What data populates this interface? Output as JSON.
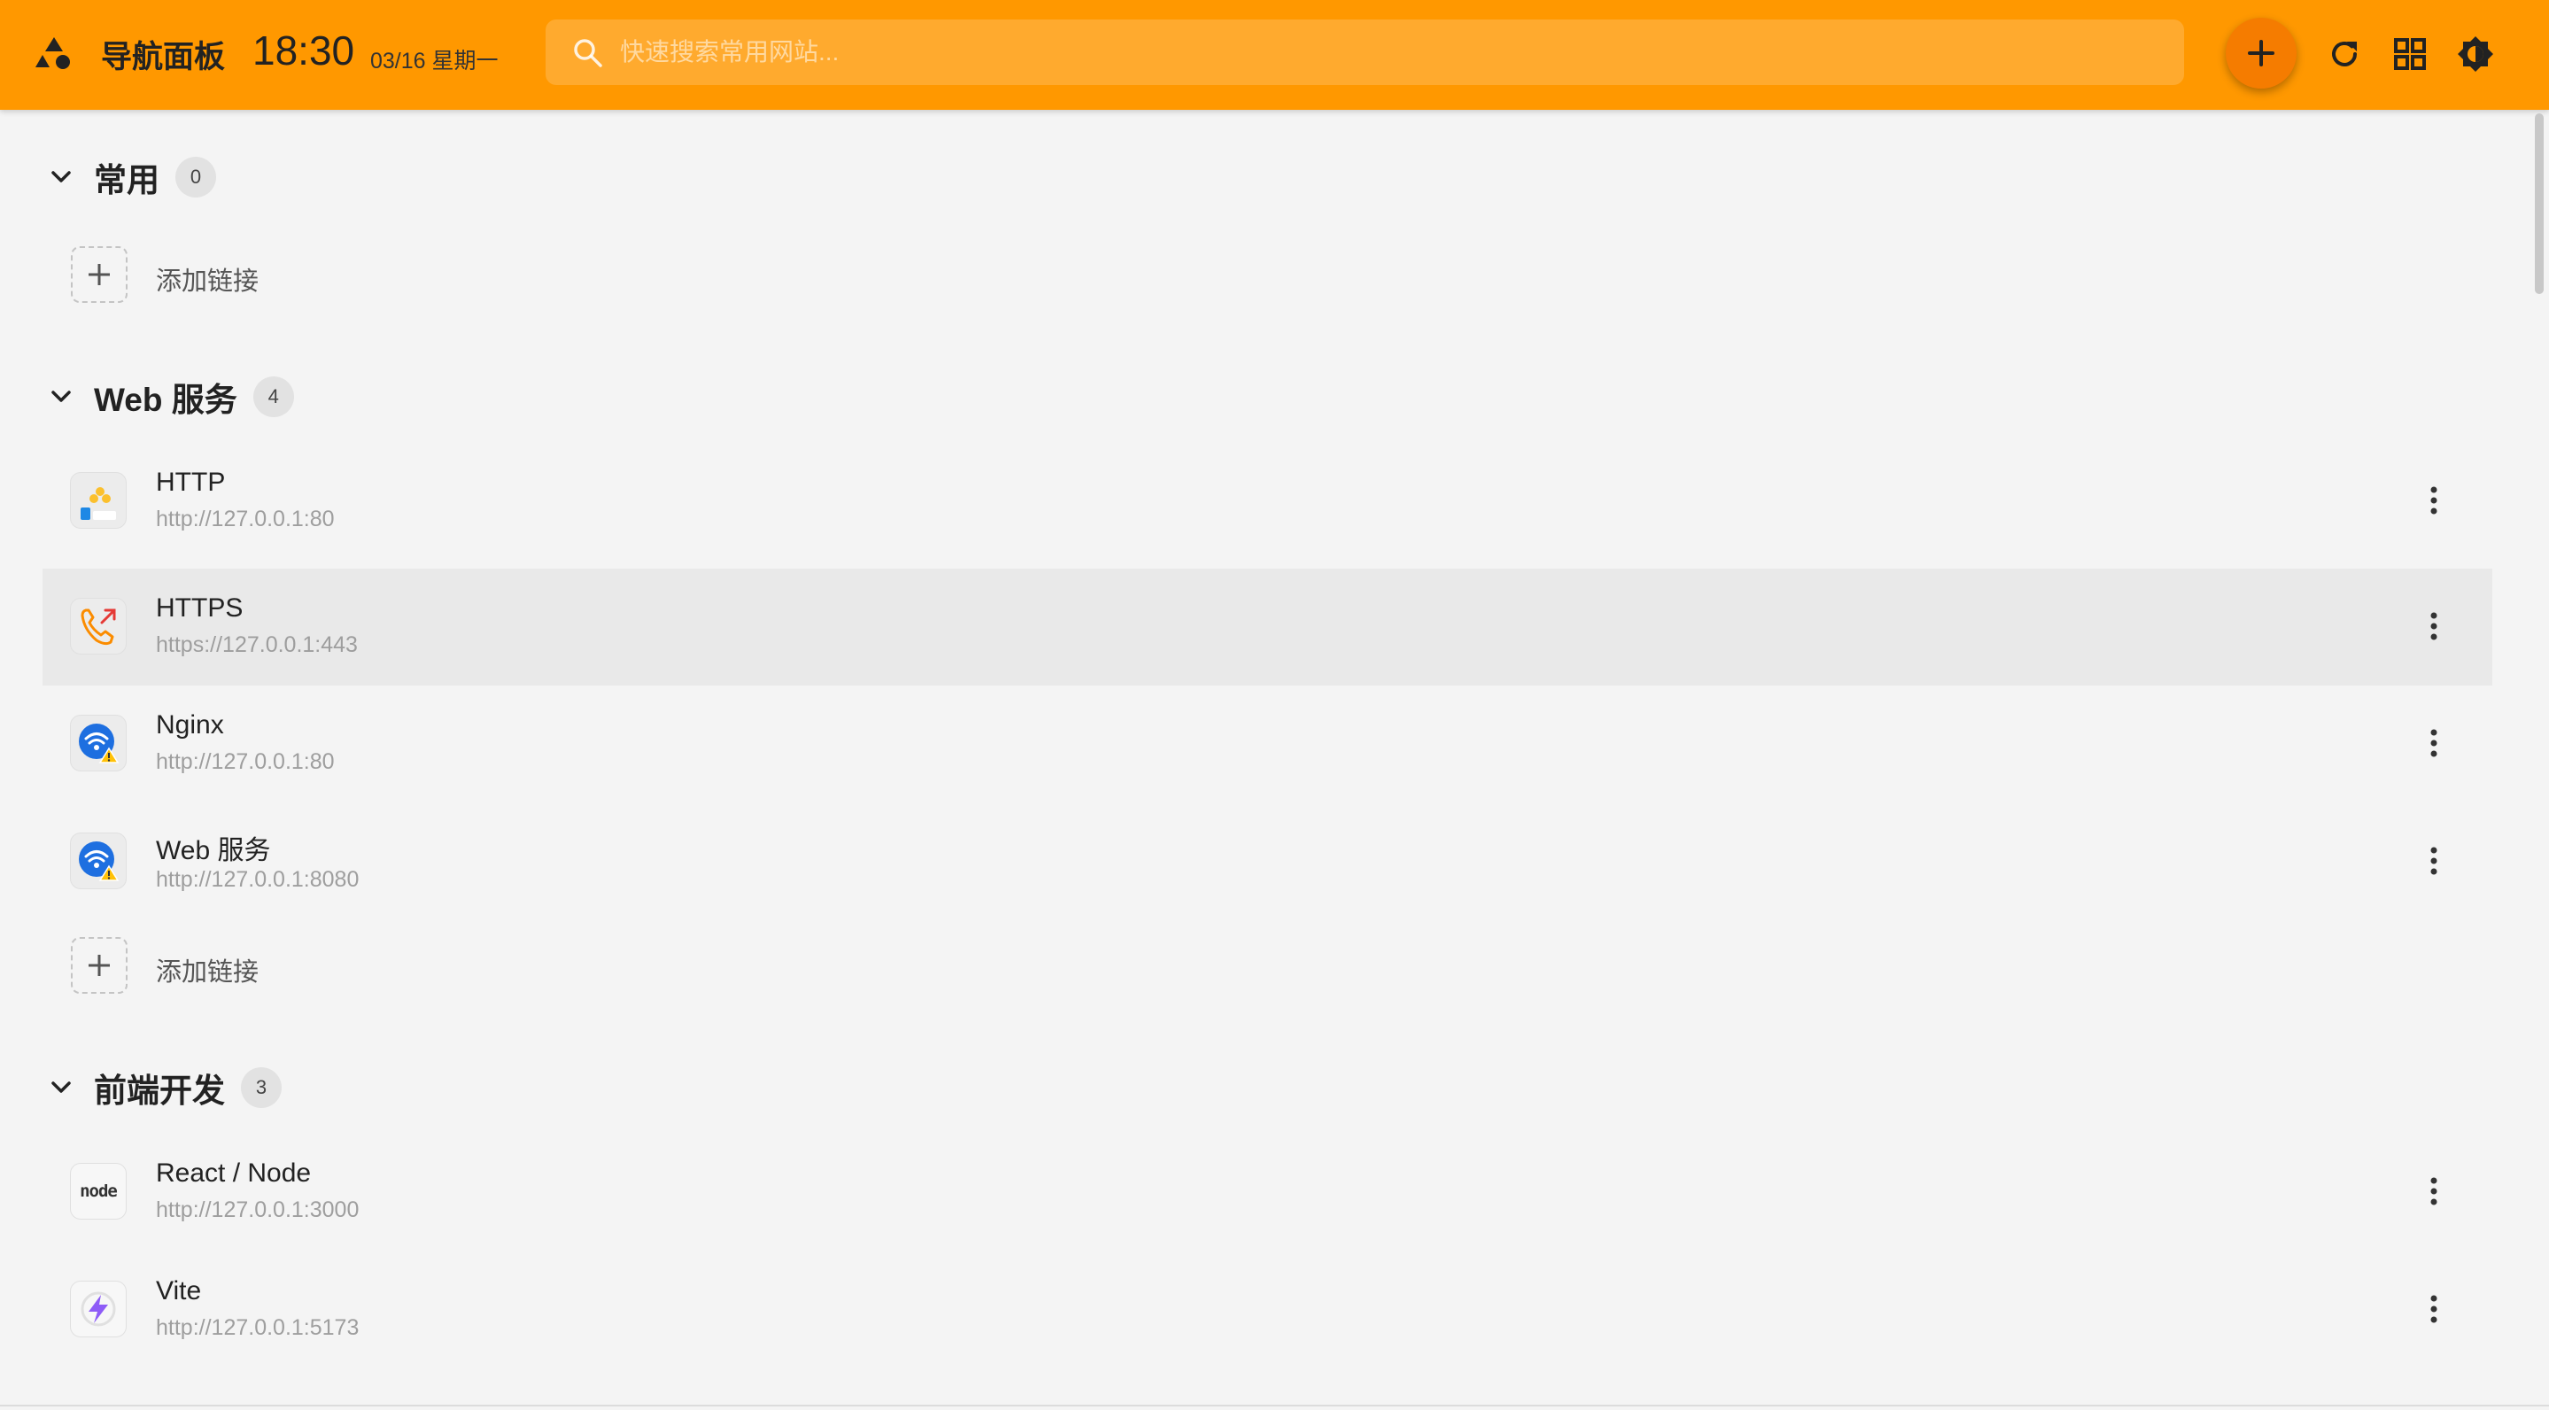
{
  "header": {
    "title": "导航面板",
    "time": "18:30",
    "date": "03/16 星期一",
    "search_placeholder": "快速搜索常用网站...",
    "icons": [
      "logo-icon",
      "search-icon",
      "add-icon",
      "refresh-icon",
      "grid-view-icon",
      "theme-toggle-icon"
    ]
  },
  "colors": {
    "accent": "#ff9800",
    "fab": "#f57c00",
    "background": "#f4f4f4"
  },
  "groups": [
    {
      "title": "常用",
      "count": "0",
      "items": [],
      "add_label": "添加链接"
    },
    {
      "title": "Web 服务",
      "count": "4",
      "items": [
        {
          "name": "HTTP",
          "url": "http://127.0.0.1:80",
          "icon": "dots-app-icon"
        },
        {
          "name": "HTTPS",
          "url": "https://127.0.0.1:443",
          "icon": "phone-outgoing-icon"
        },
        {
          "name": "Nginx",
          "url": "http://127.0.0.1:80",
          "icon": "wifi-warning-icon"
        },
        {
          "name": "Web 服务",
          "url": "http://127.0.0.1:8080",
          "icon": "wifi-warning-icon"
        }
      ],
      "add_label": "添加链接"
    },
    {
      "title": "前端开发",
      "count": "3",
      "items": [
        {
          "name": "React / Node",
          "url": "http://127.0.0.1:3000",
          "icon": "node-icon",
          "icon_text": "node"
        },
        {
          "name": "Vite",
          "url": "http://127.0.0.1:5173",
          "icon": "vite-icon"
        }
      ]
    }
  ]
}
